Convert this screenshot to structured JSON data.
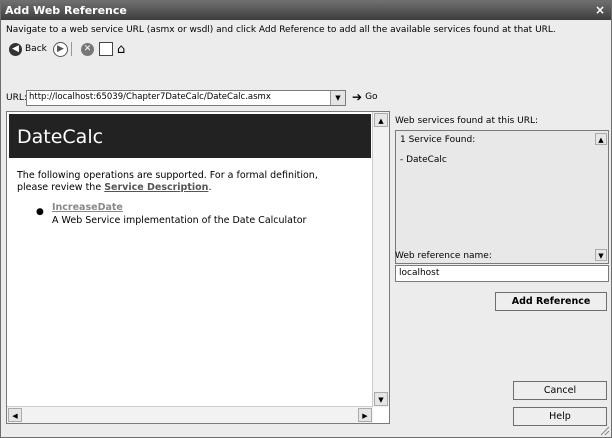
{
  "window": {
    "title": "Add Web Reference"
  },
  "instruction": "Navigate to a web service URL (asmx or wsdl) and click Add Reference to add all the available services found at that URL.",
  "nav": {
    "back_label": "Back"
  },
  "url": {
    "label": "URL:",
    "value": "http://localhost:65039/Chapter7DateCalc/DateCalc.asmx",
    "go_label": "Go"
  },
  "browser": {
    "heading": "DateCalc",
    "intro_1": "The following operations are supported. For a formal definition,",
    "intro_2": "please review the ",
    "service_link": "Service Description",
    "period": ".",
    "operation_name": "IncreaseDate",
    "operation_desc": "A Web Service implementation of the Date Calculator"
  },
  "services": {
    "label": "Web services found at this URL:",
    "found": "1 Service Found:",
    "item": "- DateCalc"
  },
  "reference": {
    "label": "Web reference name:",
    "value": "localhost"
  },
  "buttons": {
    "add_reference": "Add Reference",
    "cancel": "Cancel",
    "help": "Help"
  }
}
